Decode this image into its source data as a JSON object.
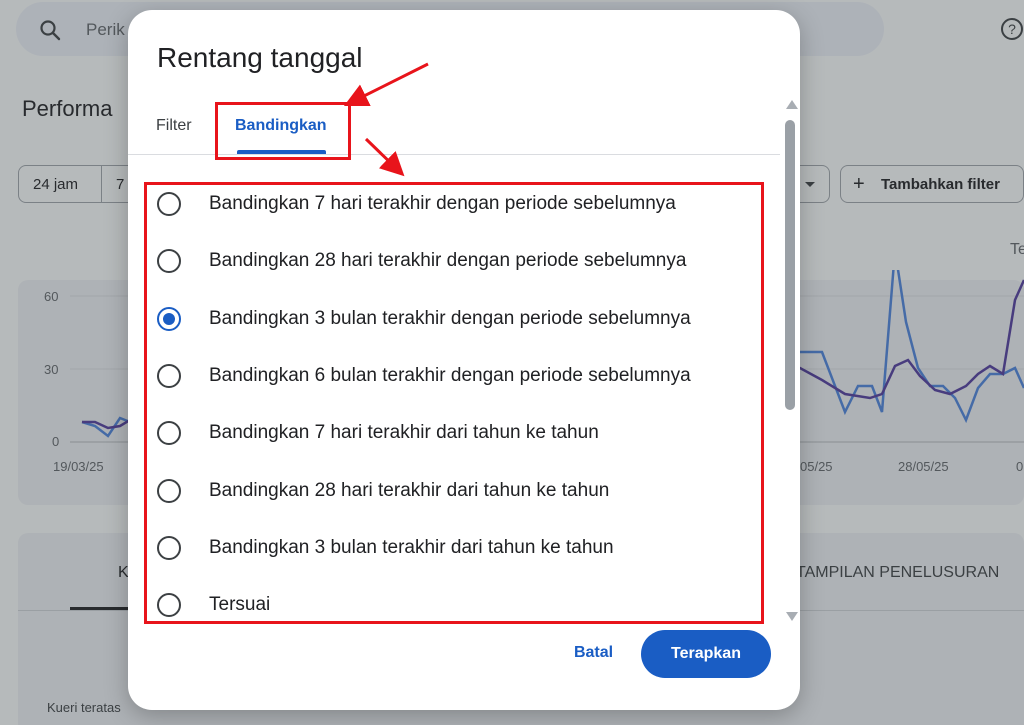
{
  "background": {
    "search_placeholder": "Perik",
    "page_title": "Performa",
    "chip_24": "24 jam",
    "chip_7": "7",
    "add_filter": "Tambahkan filter",
    "te_label": "Te",
    "chart": {
      "y_ticks": [
        "60",
        "30",
        "0"
      ],
      "x_ticks": [
        "19/03/25",
        "05/25",
        "28/05/25",
        "0"
      ]
    },
    "tab_k": "K",
    "tab_tampilan": "TAMPILAN PENELUSURAN",
    "top_queries": "Kueri teratas"
  },
  "dialog": {
    "title": "Rentang tanggal",
    "tabs": [
      {
        "label": "Filter",
        "active": false
      },
      {
        "label": "Bandingkan",
        "active": true
      }
    ],
    "options": [
      {
        "label": "Bandingkan 7 hari terakhir dengan periode sebelumnya",
        "checked": false
      },
      {
        "label": "Bandingkan 28 hari terakhir dengan periode sebelumnya",
        "checked": false
      },
      {
        "label": "Bandingkan 3 bulan terakhir dengan periode sebelumnya",
        "checked": true
      },
      {
        "label": "Bandingkan 6 bulan terakhir dengan periode sebelumnya",
        "checked": false
      },
      {
        "label": "Bandingkan 7 hari terakhir dari tahun ke tahun",
        "checked": false
      },
      {
        "label": "Bandingkan 28 hari terakhir dari tahun ke tahun",
        "checked": false
      },
      {
        "label": "Bandingkan 3 bulan terakhir dari tahun ke tahun",
        "checked": false
      },
      {
        "label": "Tersuai",
        "checked": false
      }
    ],
    "cancel_label": "Batal",
    "apply_label": "Terapkan"
  },
  "colors": {
    "accent": "#1a5dc4",
    "annotation": "#e8141b",
    "series_blue": "#4a7fd6",
    "series_purple": "#4f3a9a"
  }
}
